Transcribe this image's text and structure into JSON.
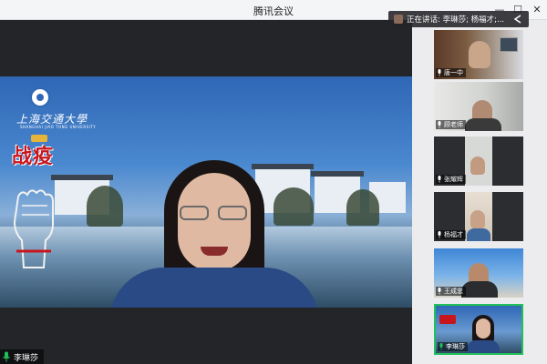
{
  "window": {
    "title": "腾讯会议"
  },
  "speaking_banner": {
    "text": "正在讲话: 李琳莎; 杨福才;..."
  },
  "main_video": {
    "participant_name": "李琳莎",
    "logo_text": "上海交通大學",
    "logo_sub": "SHANGHAI JIAO TONG UNIVERSITY",
    "poster_text": "战疫"
  },
  "participants": [
    {
      "name": "唐一中",
      "active": false
    },
    {
      "name": "顾老师",
      "active": false
    },
    {
      "name": "张耀辉",
      "active": false
    },
    {
      "name": "杨福才",
      "active": false
    },
    {
      "name": "王成忠",
      "active": false
    },
    {
      "name": "李琳莎",
      "active": true
    }
  ],
  "colors": {
    "active_border": "#21c05a",
    "title_bar": "#f4f5f7",
    "sidebar": "#ececee",
    "stage": "#232529"
  },
  "icons": [
    "microphone-icon",
    "minimize-icon",
    "maximize-icon",
    "close-icon",
    "collapse-arrow-icon"
  ]
}
